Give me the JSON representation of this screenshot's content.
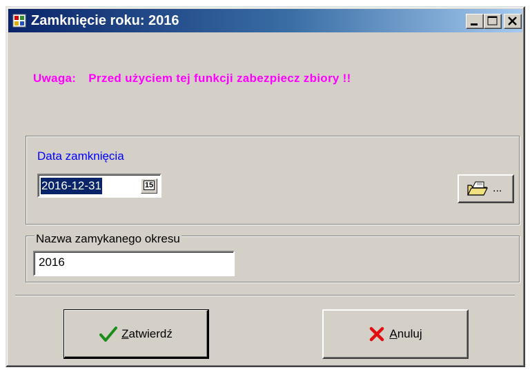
{
  "window": {
    "title": "Zamknięcie roku: 2016",
    "title_color": "#ffffff",
    "titlebar_color": "#0a246a",
    "controls": {
      "minimize_icon": "minimize-icon",
      "maximize_icon": "maximize-icon",
      "close_icon": "close-icon"
    }
  },
  "warning": {
    "prefix": "Uwaga:",
    "message": "Przed użyciem tej funkcji zabezpiecz zbiory !!",
    "color": "#ff00ff"
  },
  "closing_date": {
    "label": "Data zamknięcia",
    "label_color": "#0000ff",
    "value": "2016-12-31",
    "calendar_button_label": "15",
    "browse_button_label": "..."
  },
  "period_name": {
    "legend": "Nazwa zamykanego okresu",
    "value": "2016"
  },
  "buttons": {
    "confirm": {
      "mnemonic": "Z",
      "rest": "atwierdź",
      "icon": "checkmark-icon"
    },
    "cancel": {
      "mnemonic": "A",
      "rest": "nuluj",
      "icon": "x-cross-icon"
    }
  }
}
